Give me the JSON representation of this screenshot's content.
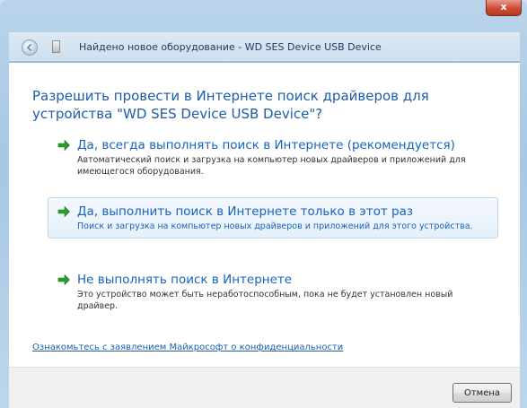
{
  "window": {
    "title": "Найдено новое оборудование - WD SES Device USB Device",
    "close_symbol": "x"
  },
  "heading": "Разрешить провести в Интернете поиск драйверов для устройства \"WD SES Device USB Device\"?",
  "options": [
    {
      "title": "Да, всегда выполнять поиск в Интернете (рекомендуется)",
      "description": "Автоматический поиск и загрузка на компьютер новых драйверов и приложений для имеющегося оборудования.",
      "icon": "green-arrow-icon",
      "selected": false
    },
    {
      "title": "Да, выполнить поиск в Интернете только в этот раз",
      "description": "Поиск и загрузка на компьютер новых драйверов и приложений для этого устройства.",
      "icon": "green-arrow-icon",
      "selected": true
    },
    {
      "title": "Не выполнять поиск в Интернете",
      "description": "Это устройство может быть неработоспособным, пока не будет установлен новый драйвер.",
      "icon": "green-arrow-icon",
      "selected": false
    }
  ],
  "privacy_link": "Ознакомьтесь с заявлением Майкрософт о конфиденциальности",
  "footer": {
    "cancel_label": "Отмена"
  },
  "colors": {
    "heading": "#1f5ca8",
    "link": "#1763c0",
    "arrow": "#2e9b2e"
  }
}
